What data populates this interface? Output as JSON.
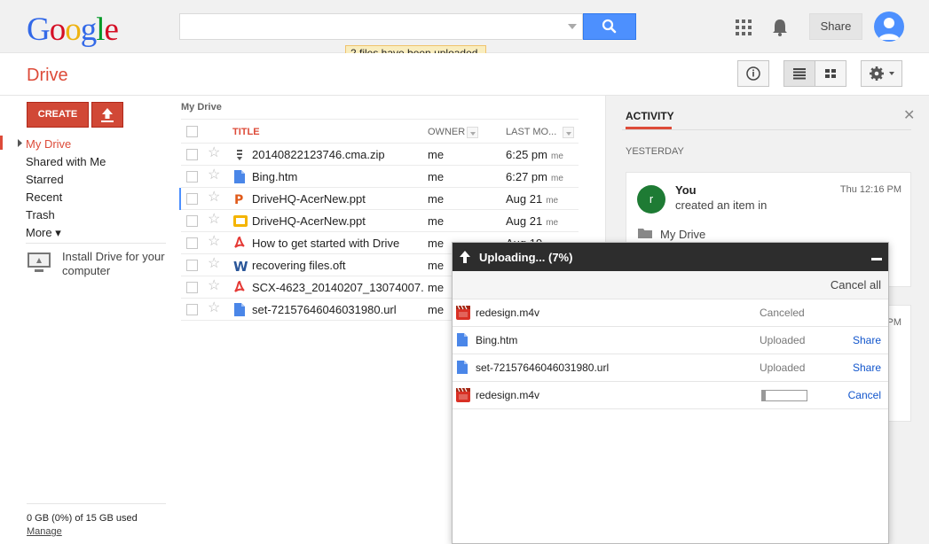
{
  "header": {
    "logo": [
      "G",
      "o",
      "o",
      "g",
      "l",
      "e"
    ],
    "logo_colors": [
      "#3369e8",
      "#d50f25",
      "#eeb211",
      "#3369e8",
      "#009925",
      "#d50f25"
    ],
    "search_placeholder": "",
    "share_label": "Share",
    "toast": "2 files have been uploaded."
  },
  "subbar": {
    "title": "Drive"
  },
  "sidebar": {
    "create_label": "CREATE",
    "nav": [
      "My Drive",
      "Shared with Me",
      "Starred",
      "Recent",
      "Trash",
      "More ▾"
    ],
    "install_text": "Install Drive for your computer",
    "quota": "0 GB (0%) of 15 GB used",
    "manage": "Manage"
  },
  "main": {
    "breadcrumb": "My Drive",
    "columns": {
      "title": "TITLE",
      "owner": "OWNER",
      "modified": "LAST MO..."
    },
    "rows": [
      {
        "icon": "zip-icon",
        "name": "20140822123746.cma.zip",
        "owner": "me",
        "modified": "6:25 pm",
        "by": "me"
      },
      {
        "icon": "doc-icon",
        "name": "Bing.htm",
        "owner": "me",
        "modified": "6:27 pm",
        "by": "me"
      },
      {
        "icon": "ppt-icon",
        "name": "DriveHQ-AcerNew.ppt",
        "owner": "me",
        "modified": "Aug 21",
        "by": "me"
      },
      {
        "icon": "slides-icon",
        "name": "DriveHQ-AcerNew.ppt",
        "owner": "me",
        "modified": "Aug 21",
        "by": "me"
      },
      {
        "icon": "pdf-icon",
        "name": "How to get started with Drive",
        "owner": "me",
        "modified": "Aug 19",
        "by": ""
      },
      {
        "icon": "word-icon",
        "name": "recovering files.oft",
        "owner": "me",
        "modified": "",
        "by": ""
      },
      {
        "icon": "pdf-icon",
        "name": "SCX-4623_20140207_13074007.p",
        "owner": "me",
        "modified": "",
        "by": ""
      },
      {
        "icon": "doc-icon",
        "name": "set-72157646046031980.url",
        "owner": "me",
        "modified": "",
        "by": ""
      }
    ]
  },
  "activity": {
    "tab": "ACTIVITY",
    "close": "✕",
    "section": "YESTERDAY",
    "card": {
      "avatar_letter": "r",
      "user": "You",
      "action": "created an item in",
      "time": "Thu 12:16 PM",
      "folder": "My Drive"
    },
    "card2_time": "PM"
  },
  "upload": {
    "title": "Uploading... (7%)",
    "cancel_all": "Cancel all",
    "items": [
      {
        "icon": "video-icon",
        "name": "redesign.m4v",
        "status": "Canceled",
        "action": ""
      },
      {
        "icon": "doc-icon",
        "name": "Bing.htm",
        "status": "Uploaded",
        "action": "Share"
      },
      {
        "icon": "doc-icon",
        "name": "set-72157646046031980.url",
        "status": "Uploaded",
        "action": "Share"
      },
      {
        "icon": "video-icon",
        "name": "redesign.m4v",
        "status": "",
        "action": "Cancel",
        "progress": 0.07
      }
    ]
  }
}
